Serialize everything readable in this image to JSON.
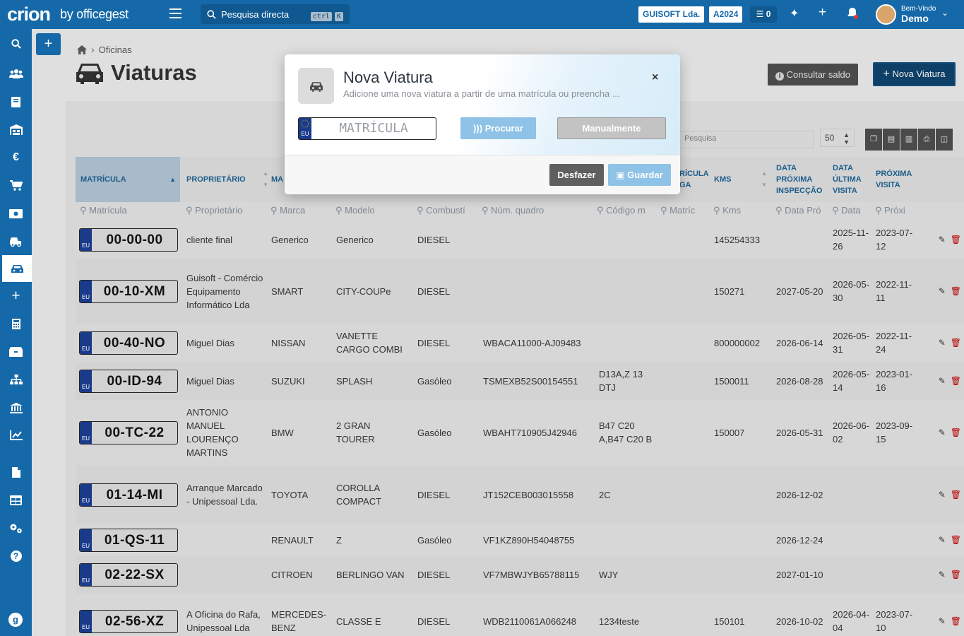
{
  "topbar": {
    "logo": "crion",
    "logo_by": "by officegest",
    "search_placeholder": "Pesquisa directa",
    "search_kbd1": "ctrl",
    "search_kbd2": "K",
    "company": "GUISOFT Lda.",
    "year": "A2024",
    "tasks_count": "0",
    "welcome_line1": "Bem-Vindo",
    "welcome_line2": "Demo"
  },
  "sidebar": {
    "items": [
      "search-icon",
      "users-icon",
      "book-icon",
      "warehouse-icon",
      "euro-icon",
      "cart-icon",
      "money-icon",
      "truck-icon",
      "car-icon",
      "plus-icon",
      "calculator-icon",
      "boxes-icon",
      "sitemap-icon",
      "bank-icon",
      "chart-icon",
      "file-icon",
      "table-icon",
      "gears-icon",
      "help-icon"
    ],
    "active": "car-icon"
  },
  "page": {
    "breadcrumb": "Oficinas",
    "title": "Viaturas",
    "btn_saldo": "Consultar saldo",
    "btn_nova": "Nova Viatura",
    "table_search_placeholder": "Pesquisa",
    "page_size": "50"
  },
  "table": {
    "headers": [
      "MATRÍCULA",
      "PROPRIETÁRIO",
      "MA",
      "RÍCULA GA",
      "KMS",
      "DATA PRÓXIMA INSPECÇÃO",
      "DATA ÚLTIMA VISITA",
      "PRÓXIMA VISITA"
    ],
    "filters": [
      "Matrícula",
      "Proprietário",
      "Marca",
      "Modelo",
      "Combustí",
      "Núm. quadro",
      "Código m",
      "Matríc",
      "Kms",
      "Data Pró",
      "Data",
      "Próxi"
    ],
    "rows": [
      {
        "plate": "00-00-00",
        "owner": "cliente final",
        "brand": "Generico",
        "model": "Generico",
        "fuel": "DIESEL",
        "vin": "",
        "code": "",
        "kms": "145254333",
        "insp": "",
        "last": "2025-11-26",
        "next": "2023-07-12"
      },
      {
        "plate": "00-10-XM",
        "owner": "Guisoft - Comércio Equipamento Informático Lda",
        "brand": "SMART",
        "model": "CITY-COUPe",
        "fuel": "DIESEL",
        "vin": "",
        "code": "",
        "kms": "150271",
        "insp": "2027-05-20",
        "last": "2026-05-30",
        "next": "2022-11-11"
      },
      {
        "plate": "00-40-NO",
        "owner": "Miguel Dias",
        "brand": "NISSAN",
        "model": "VANETTE CARGO COMBI",
        "fuel": "DIESEL",
        "vin": "WBACA11000-AJ09483",
        "code": "",
        "kms": "800000002",
        "insp": "2026-06-14",
        "last": "2026-05-31",
        "next": "2022-11-24"
      },
      {
        "plate": "00-ID-94",
        "owner": "Miguel Dias",
        "brand": "SUZUKI",
        "model": "SPLASH",
        "fuel": "Gasóleo",
        "vin": "TSMEXB52S00154551",
        "code": "D13A,Z 13 DTJ",
        "kms": "1500011",
        "insp": "2026-08-28",
        "last": "2026-05-14",
        "next": "2023-01-16"
      },
      {
        "plate": "00-TC-22",
        "owner": "ANTONIO MANUEL LOURENÇO MARTINS",
        "brand": "BMW",
        "model": "2 GRAN TOURER",
        "fuel": "Gasóleo",
        "vin": "WBAHT710905J42946",
        "code": "B47 C20 A,B47 C20 B",
        "kms": "150007",
        "insp": "2026-05-31",
        "last": "2026-06-02",
        "next": "2023-09-15"
      },
      {
        "plate": "01-14-MI",
        "owner": "Arranque Marcado - Unipessoal Lda.",
        "brand": "TOYOTA",
        "model": "COROLLA COMPACT",
        "fuel": "DIESEL",
        "vin": "JT152CEB003015558",
        "code": "2C",
        "kms": "",
        "insp": "2026-12-02",
        "last": "",
        "next": ""
      },
      {
        "plate": "01-QS-11",
        "owner": "",
        "brand": "RENAULT",
        "model": "Z",
        "fuel": "Gasóleo",
        "vin": "VF1KZ890H54048755",
        "code": "",
        "kms": "",
        "insp": "2026-12-24",
        "last": "",
        "next": ""
      },
      {
        "plate": "02-22-SX",
        "owner": "",
        "brand": "CITROEN",
        "model": "BERLINGO VAN",
        "fuel": "DIESEL",
        "vin": "VF7MBWJYB65788115",
        "code": "WJY",
        "kms": "",
        "insp": "2027-01-10",
        "last": "",
        "next": ""
      },
      {
        "plate": "02-56-XZ",
        "owner": "A Oficina do Rafa, Unipessoal Lda",
        "brand": "MERCEDES-BENZ",
        "model": "CLASSE E",
        "fuel": "DIESEL",
        "vin": "WDB2110061A066248",
        "code": "1234teste",
        "kms": "150101",
        "insp": "2026-10-02",
        "last": "2026-04-04",
        "next": "2023-07-10"
      }
    ]
  },
  "modal": {
    "title": "Nova Viatura",
    "subtitle": "Adicione uma nova viatura a partir de uma matrícula ou preencha ...",
    "plate_placeholder": "MATRÍCULA",
    "eu_label": "EU",
    "btn_procurar": "Procurar",
    "btn_manual": "Manualmente",
    "btn_desfazer": "Desfazer",
    "btn_guardar": "Guardar",
    "close": "×"
  }
}
